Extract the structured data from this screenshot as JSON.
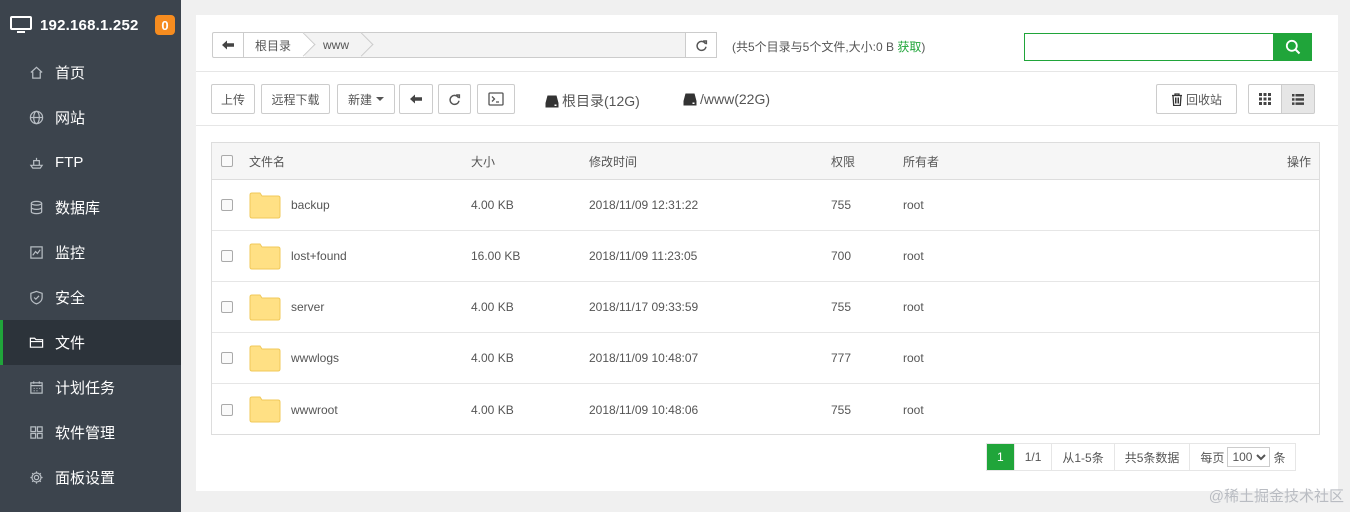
{
  "server": {
    "ip": "192.168.1.252",
    "badge": "0"
  },
  "sidebar": {
    "items": [
      {
        "label": "首页",
        "icon": "home-icon"
      },
      {
        "label": "网站",
        "icon": "globe-icon"
      },
      {
        "label": "FTP",
        "icon": "ftp-icon"
      },
      {
        "label": "数据库",
        "icon": "database-icon"
      },
      {
        "label": "监控",
        "icon": "monitor-chart-icon"
      },
      {
        "label": "安全",
        "icon": "shield-icon"
      },
      {
        "label": "文件",
        "icon": "folder-icon",
        "active": true
      },
      {
        "label": "计划任务",
        "icon": "calendar-icon"
      },
      {
        "label": "软件管理",
        "icon": "apps-grid-icon"
      },
      {
        "label": "面板设置",
        "icon": "gear-icon"
      }
    ]
  },
  "path": {
    "root": "根目录",
    "dir": "www"
  },
  "summary": {
    "text": "(共5个目录与5个文件,大小:0 B ",
    "fetch": "获取",
    "close": ")"
  },
  "search": {
    "value": ""
  },
  "toolbar": {
    "upload": "上传",
    "remote_download": "远程下载",
    "new": "新建",
    "disk_root": "根目录(12G)",
    "disk_www": "/www(22G)",
    "recycle": "回收站"
  },
  "table": {
    "headers": {
      "name": "文件名",
      "size": "大小",
      "mtime": "修改时间",
      "perm": "权限",
      "owner": "所有者",
      "action": "操作"
    },
    "rows": [
      {
        "name": "backup",
        "size": "4.00 KB",
        "mtime": "2018/11/09 12:31:22",
        "perm": "755",
        "owner": "root"
      },
      {
        "name": "lost+found",
        "size": "16.00 KB",
        "mtime": "2018/11/09 11:23:05",
        "perm": "700",
        "owner": "root"
      },
      {
        "name": "server",
        "size": "4.00 KB",
        "mtime": "2018/11/17 09:33:59",
        "perm": "755",
        "owner": "root"
      },
      {
        "name": "wwwlogs",
        "size": "4.00 KB",
        "mtime": "2018/11/09 10:48:07",
        "perm": "777",
        "owner": "root"
      },
      {
        "name": "wwwroot",
        "size": "4.00 KB",
        "mtime": "2018/11/09 10:48:06",
        "perm": "755",
        "owner": "root"
      }
    ]
  },
  "pager": {
    "current": "1",
    "of": "1/1",
    "range": "从1-5条",
    "total": "共5条数据",
    "per_page_label": "每页",
    "per_page_value": "100",
    "unit": "条"
  },
  "colors": {
    "accent": "#20a53a",
    "sidebar_bg": "#3c444d",
    "badge": "#f68c1f"
  },
  "watermark": "@稀土掘金技术社区"
}
